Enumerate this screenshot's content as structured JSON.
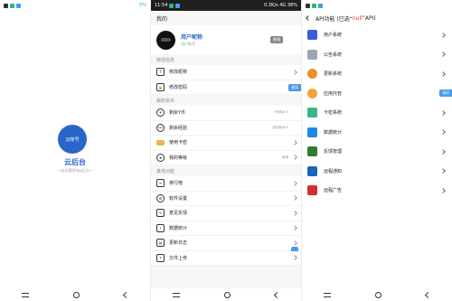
{
  "panel1": {
    "statusbar": {
      "right": "5%"
    },
    "logo_text": "云帐号",
    "title": "云后台",
    "subtitle": "一站式通用App后台一"
  },
  "panel2": {
    "statusbar": {
      "time": "11:54",
      "right": "0.3K/s 4G 38%"
    },
    "header": "我的",
    "profile": {
      "name": "用户昵称",
      "id": "用户账号",
      "tag": "普通"
    },
    "sections": [
      {
        "title": "修改信息",
        "rows": [
          {
            "icon": "T",
            "label": "修改昵称",
            "value": ""
          },
          {
            "icon": "lock",
            "label": "修改密码",
            "value": ""
          }
        ]
      },
      {
        "title": "我的货币",
        "rows": [
          {
            "icon": "¥",
            "label": "剩余Y币",
            "value": "Y币剩余:5"
          },
          {
            "icon": "exp",
            "label": "剩余经验",
            "value": "经验剩余:0"
          },
          {
            "icon": "card",
            "label": "使用卡密",
            "value": ""
          },
          {
            "icon": "level",
            "label": "我的等级",
            "value": "普通"
          }
        ]
      },
      {
        "title": "其他功能",
        "rows": [
          {
            "icon": "rank",
            "label": "排行榜",
            "value": ""
          },
          {
            "icon": "gear",
            "label": "软件设置",
            "value": ""
          },
          {
            "icon": "edit",
            "label": "意见反馈",
            "value": ""
          },
          {
            "icon": "chart",
            "label": "数据统计",
            "value": ""
          },
          {
            "icon": "log",
            "label": "更新日志",
            "value": ""
          },
          {
            "icon": "upload",
            "label": "文件上传",
            "value": ""
          }
        ]
      }
    ],
    "float_tag": "调试"
  },
  "panel3": {
    "header_prefix": "API功能 (已选“",
    "header_null": "null",
    "header_suffix": "”API)",
    "float_tag": "调试",
    "items": [
      {
        "label": "用户系统",
        "color": "#3b5bdb"
      },
      {
        "label": "公告系统",
        "color": "#9aa6b2"
      },
      {
        "label": "更新系统",
        "color": "#e8912b"
      },
      {
        "label": "应用托管",
        "color": "#f2a33a"
      },
      {
        "label": "卡密系统",
        "color": "#38b48b"
      },
      {
        "label": "数据统计",
        "color": "#1e88e5"
      },
      {
        "label": "反馈管理",
        "color": "#2e7d32"
      },
      {
        "label": "远程通知",
        "color": "#1565c0"
      },
      {
        "label": "远程广告",
        "color": "#d32f2f"
      }
    ]
  }
}
